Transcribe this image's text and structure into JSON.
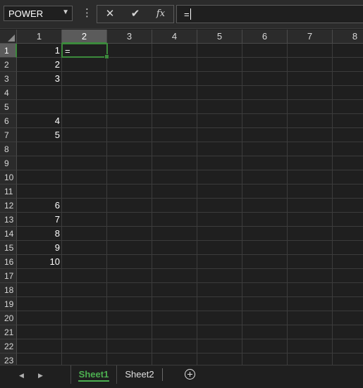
{
  "formula_bar": {
    "name_box": "POWER",
    "name_box_arrow": "▼",
    "more": "⋮",
    "cancel": "✕",
    "enter": "✔",
    "insert_function": "fx",
    "formula": "="
  },
  "columns": [
    "1",
    "2",
    "3",
    "4",
    "5",
    "6",
    "7",
    "8"
  ],
  "rows": [
    "1",
    "2",
    "3",
    "4",
    "5",
    "6",
    "7",
    "8",
    "9",
    "10",
    "11",
    "12",
    "13",
    "14",
    "15",
    "16",
    "17",
    "18",
    "19",
    "20",
    "21",
    "22",
    "23"
  ],
  "active": {
    "column": "2",
    "row": "1",
    "text": "="
  },
  "column_a_values": [
    "1",
    "2",
    "3",
    "",
    "",
    "4",
    "5",
    "",
    "",
    "",
    "",
    "6",
    "7",
    "8",
    "9",
    "10",
    "",
    "",
    "",
    "",
    "",
    "",
    ""
  ],
  "sheets": {
    "prev": "◀",
    "next": "▶",
    "tab1": "Sheet1",
    "tab2": "Sheet2",
    "add": "add-sheet"
  },
  "colors": {
    "accent": "#3c8a3c",
    "background": "#1f1f1f",
    "header": "#2b2b2b"
  }
}
